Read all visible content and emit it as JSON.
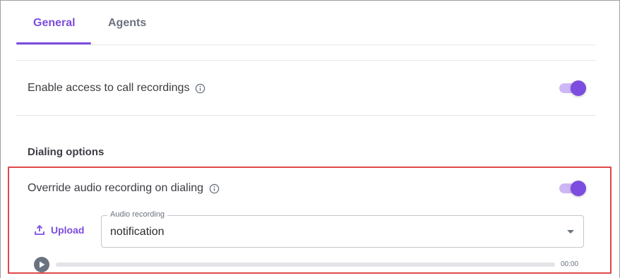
{
  "tabs": [
    {
      "label": "General",
      "active": true
    },
    {
      "label": "Agents",
      "active": false
    }
  ],
  "call_recordings": {
    "label": "Enable access to call recordings",
    "info_icon": "info-icon",
    "enabled": true
  },
  "dialing_options": {
    "title": "Dialing options",
    "override": {
      "label": "Override audio recording on dialing",
      "info_icon": "info-icon",
      "enabled": true
    },
    "upload_label": "Upload",
    "audio_select": {
      "legend": "Audio recording",
      "value": "notification"
    },
    "player": {
      "time": "00:00",
      "progress": 0
    }
  },
  "colors": {
    "accent": "#7c4ddf",
    "accent_light": "#cdb8f5",
    "highlight": "#e04848"
  }
}
